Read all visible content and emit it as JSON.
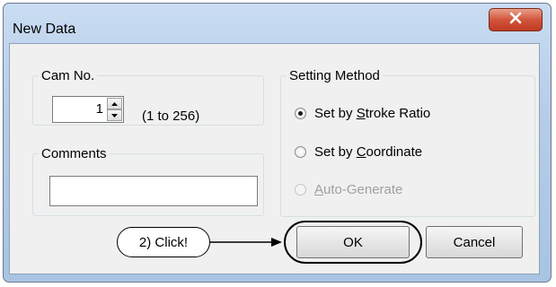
{
  "window": {
    "title": "New Data",
    "close_icon": "close-x-icon"
  },
  "cam_group": {
    "legend": "Cam No.",
    "value": "1",
    "range": "(1 to 256)"
  },
  "comments_group": {
    "legend": "Comments",
    "value": ""
  },
  "setting_method": {
    "legend": "Setting Method",
    "options": [
      {
        "pre": "Set by ",
        "key": "S",
        "post": "troke Ratio",
        "checked": true,
        "disabled": false
      },
      {
        "pre": "Set by ",
        "key": "C",
        "post": "oordinate",
        "checked": false,
        "disabled": false
      },
      {
        "pre": "",
        "key": "A",
        "post": "uto-Generate",
        "checked": false,
        "disabled": true
      }
    ]
  },
  "buttons": {
    "ok": "OK",
    "cancel": "Cancel"
  },
  "annotation": {
    "text": "2) Click!"
  },
  "colors": {
    "close_button": "#c9432b",
    "title_bar": "#b9d1ea",
    "client_bg": "#f0f0f0"
  }
}
